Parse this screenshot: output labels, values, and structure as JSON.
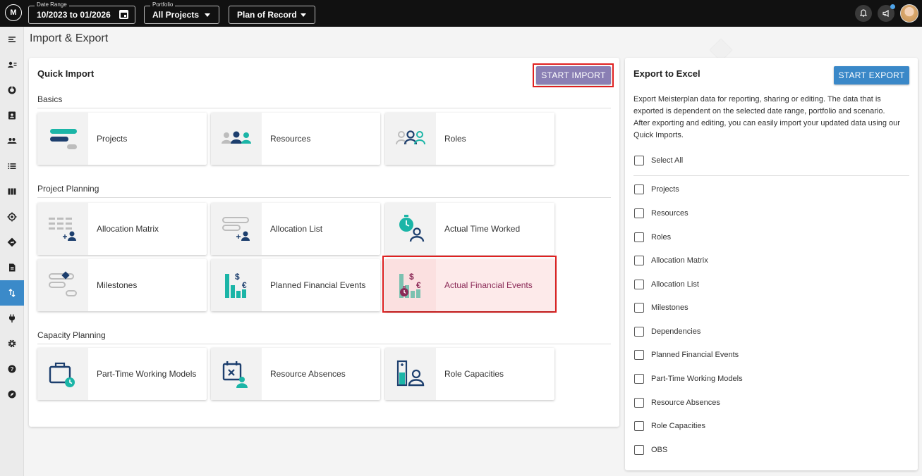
{
  "topbar": {
    "logo_text": "M",
    "date_range": {
      "legend": "Date Range",
      "value": "10/2023 to 01/2026"
    },
    "portfolio": {
      "legend": "Portfolio",
      "value": "All Projects"
    },
    "scenario": {
      "value": "Plan of Record"
    }
  },
  "page": {
    "title": "Import & Export"
  },
  "quick_import": {
    "title": "Quick Import",
    "button": "START IMPORT",
    "sections": [
      {
        "title": "Basics",
        "cards": [
          "Projects",
          "Resources",
          "Roles"
        ]
      },
      {
        "title": "Project Planning",
        "cards": [
          "Allocation Matrix",
          "Allocation List",
          "Actual Time Worked",
          "Milestones",
          "Planned Financial Events",
          "Actual Financial Events"
        ]
      },
      {
        "title": "Capacity Planning",
        "cards": [
          "Part-Time Working Models",
          "Resource Absences",
          "Role Capacities"
        ]
      }
    ]
  },
  "export": {
    "title": "Export to Excel",
    "button": "START EXPORT",
    "description": "Export Meisterplan data for reporting, sharing or editing. The data that is exported is dependent on the selected date range, portfolio and scenario. After exporting and editing, you can easily import your updated data using our Quick Imports.",
    "select_all": "Select All",
    "options": [
      "Projects",
      "Resources",
      "Roles",
      "Allocation Matrix",
      "Allocation List",
      "Milestones",
      "Dependencies",
      "Planned Financial Events",
      "Part-Time Working Models",
      "Resource Absences",
      "Role Capacities",
      "OBS"
    ]
  },
  "colors": {
    "accent": "#3a88c8",
    "import_button": "#8a7fb4",
    "icon_teal": "#1bb5a7",
    "icon_navy": "#1d3f6e",
    "highlight": "#e02020"
  }
}
